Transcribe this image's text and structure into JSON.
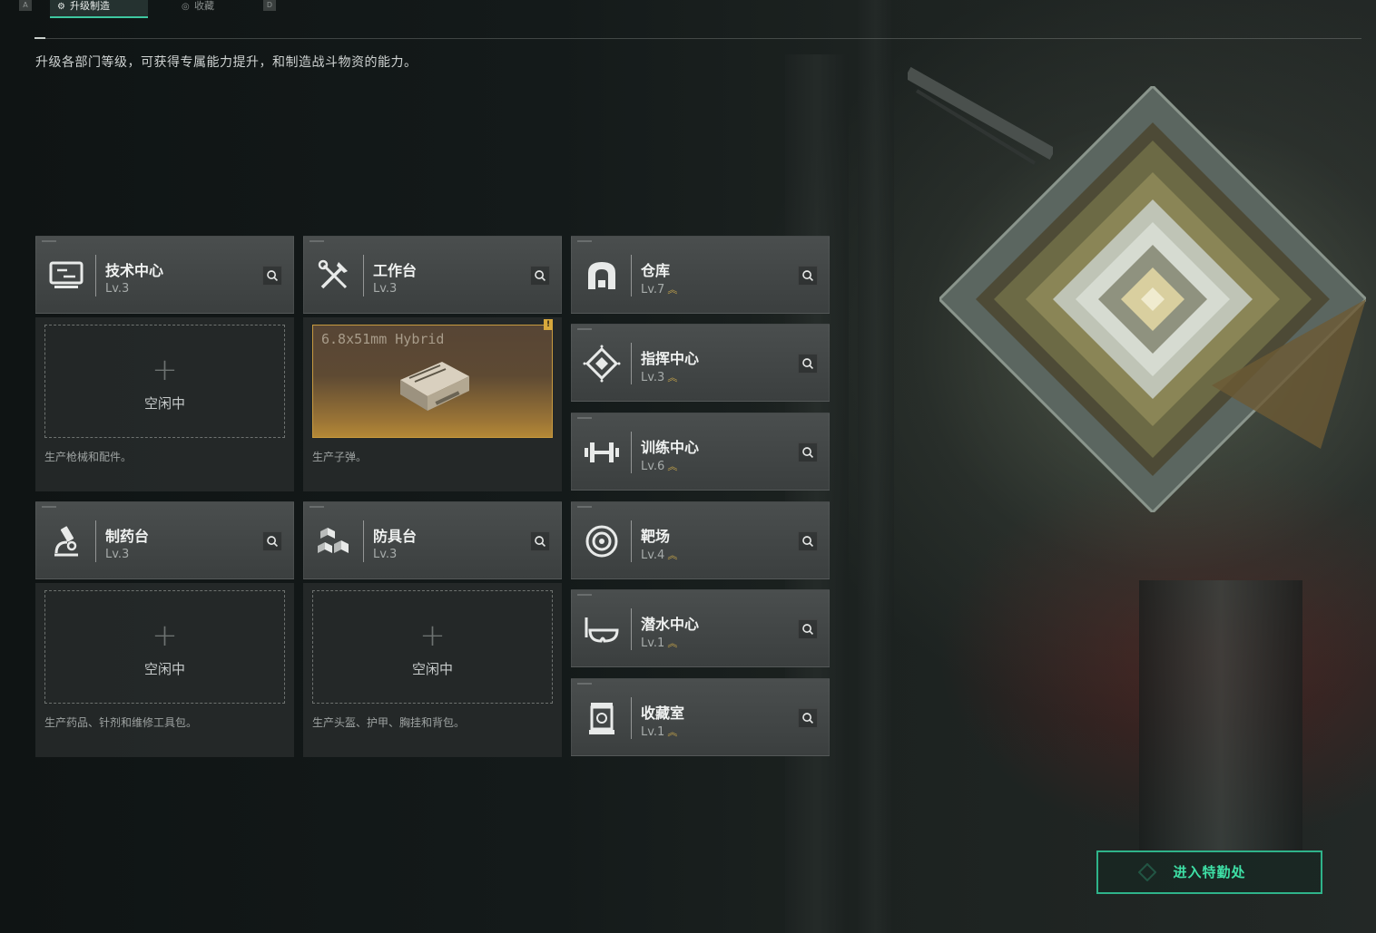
{
  "tabs": [
    {
      "key": "A"
    },
    {
      "label": "升级制造",
      "active": true
    },
    {
      "label": "收藏"
    },
    {
      "key": "D"
    }
  ],
  "intro": "升级各部门等级，可获得专属能力提升，和制造战斗物资的能力。",
  "stations": {
    "tech": {
      "name": "技术中心",
      "level": "Lv.3",
      "icon": "monitor-icon"
    },
    "workbench": {
      "name": "工作台",
      "level": "Lv.3",
      "icon": "tools-icon"
    },
    "pharmacy": {
      "name": "制药台",
      "level": "Lv.3",
      "icon": "microscope-icon"
    },
    "armor": {
      "name": "防具台",
      "level": "Lv.3",
      "icon": "blocks-icon"
    }
  },
  "slots": {
    "tech": {
      "plus": "+",
      "status": "空闲中",
      "desc": "生产枪械和配件。"
    },
    "workbench": {
      "product": "6.8x51mm Hybrid",
      "badge": "!",
      "desc": "生产子弹。"
    },
    "pharmacy": {
      "plus": "+",
      "status": "空闲中",
      "desc": "生产药品、针剂和维修工具包。"
    },
    "armor": {
      "plus": "+",
      "status": "空闲中",
      "desc": "生产头盔、护甲、胸挂和背包。"
    }
  },
  "facilities": [
    {
      "name": "仓库",
      "level": "Lv.7",
      "upgrade": "︽",
      "icon": "vault-icon"
    },
    {
      "name": "指挥中心",
      "level": "Lv.3",
      "upgrade": "︽",
      "icon": "command-icon"
    },
    {
      "name": "训练中心",
      "level": "Lv.6",
      "upgrade": "︽",
      "icon": "dumbbell-icon"
    },
    {
      "name": "靶场",
      "level": "Lv.4",
      "upgrade": "︽",
      "icon": "target-icon"
    },
    {
      "name": "潜水中心",
      "level": "Lv.1",
      "upgrade": "︽",
      "icon": "goggles-icon"
    },
    {
      "name": "收藏室",
      "level": "Lv.1",
      "upgrade": "︽",
      "icon": "display-case-icon"
    }
  ],
  "enter_button": "进入特勤处",
  "colors": {
    "accent": "#3ee0a6",
    "gold": "#c9a64a",
    "card": "#43474a"
  }
}
